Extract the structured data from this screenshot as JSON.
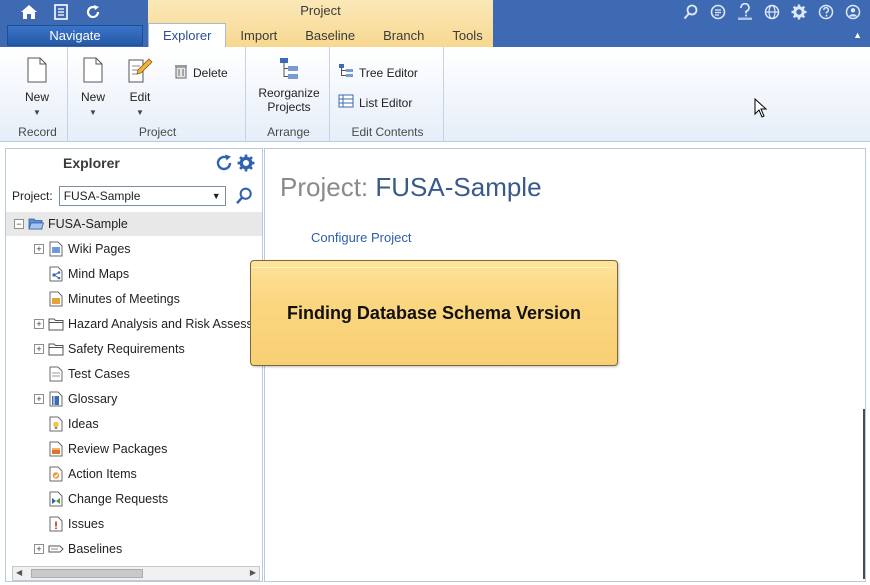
{
  "app": {
    "context_tab_title": "Project",
    "navigate_label": "Navigate"
  },
  "tabs": [
    {
      "label": "Explorer",
      "active": true
    },
    {
      "label": "Import",
      "active": false
    },
    {
      "label": "Baseline",
      "active": false
    },
    {
      "label": "Branch",
      "active": false
    },
    {
      "label": "Tools",
      "active": false
    }
  ],
  "titlebar_icons_right": [
    "search-icon",
    "list-icon",
    "how-icon",
    "globe-icon",
    "gear-icon",
    "help-icon",
    "user-icon"
  ],
  "ribbon": {
    "groups": {
      "record": {
        "label": "Record",
        "new_label": "New"
      },
      "project": {
        "label": "Project",
        "new_label": "New",
        "edit_label": "Edit",
        "delete_label": "Delete"
      },
      "arrange": {
        "label": "Arrange",
        "reorganize_line1": "Reorganize",
        "reorganize_line2": "Projects"
      },
      "edit_contents": {
        "label": "Edit Contents",
        "tree_editor": "Tree Editor",
        "list_editor": "List Editor"
      }
    }
  },
  "explorer": {
    "title": "Explorer",
    "project_label": "Project:",
    "project_value": "FUSA-Sample",
    "tree": [
      {
        "label": "FUSA-Sample",
        "icon": "folder-open-icon",
        "expander": "−",
        "level": 0
      },
      {
        "label": "Wiki Pages",
        "icon": "wiki-icon",
        "expander": "+",
        "level": 1
      },
      {
        "label": "Mind Maps",
        "icon": "mindmap-icon",
        "expander": "",
        "level": 1
      },
      {
        "label": "Minutes of Meetings",
        "icon": "minutes-icon",
        "expander": "",
        "level": 1
      },
      {
        "label": "Hazard Analysis and Risk Assessment",
        "icon": "folder-icon",
        "expander": "+",
        "level": 1
      },
      {
        "label": "Safety Requirements",
        "icon": "folder-icon",
        "expander": "+",
        "level": 1
      },
      {
        "label": "Test Cases",
        "icon": "test-icon",
        "expander": "",
        "level": 1
      },
      {
        "label": "Glossary",
        "icon": "glossary-icon",
        "expander": "+",
        "level": 1
      },
      {
        "label": "Ideas",
        "icon": "idea-icon",
        "expander": "",
        "level": 1
      },
      {
        "label": "Review Packages",
        "icon": "review-icon",
        "expander": "",
        "level": 1
      },
      {
        "label": "Action Items",
        "icon": "action-icon",
        "expander": "",
        "level": 1
      },
      {
        "label": "Change Requests",
        "icon": "change-icon",
        "expander": "",
        "level": 1
      },
      {
        "label": "Issues",
        "icon": "issue-icon",
        "expander": "",
        "level": 1
      },
      {
        "label": "Baselines",
        "icon": "baseline-icon",
        "expander": "+",
        "level": 1
      }
    ]
  },
  "main": {
    "title_prefix": "Project:",
    "title_name": "FUSA-Sample",
    "configure_link": "Configure Project"
  },
  "callout": {
    "text": "Finding Database Schema Version"
  },
  "colors": {
    "titlebar": "#3d6ab3",
    "context_band": "#f7d890",
    "callout": "#fbd680",
    "link": "#2d5fa8"
  }
}
